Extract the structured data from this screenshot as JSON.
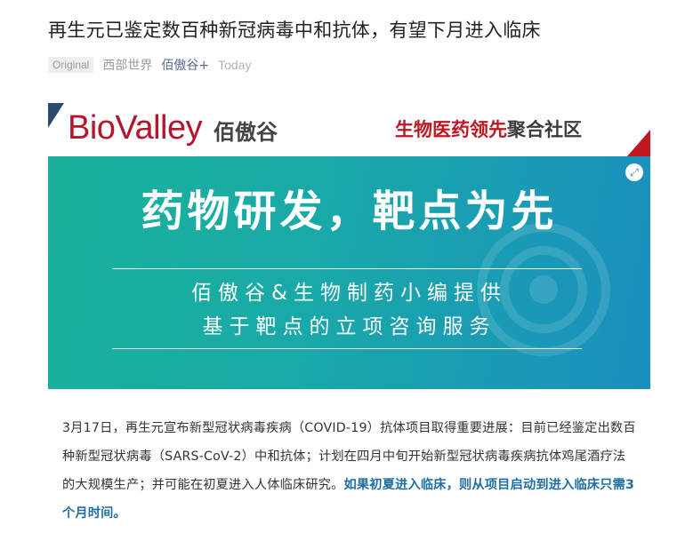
{
  "article": {
    "title": "再生元已鉴定数百种新冠病毒中和抗体，有望下月进入临床",
    "badge": "Original",
    "source": "西部世界",
    "author": "佰傲谷+",
    "date": "Today"
  },
  "banner": {
    "logo_text": "BioValley",
    "logo_cn": "佰傲谷",
    "slogan_red": "生物医药领先",
    "slogan_gray": "聚合社区",
    "headline": "药物研发，靶点为先",
    "sub1": "佰傲谷&生物制药小编提供",
    "sub2": "基于靶点的立项咨询服务",
    "expand_icon": "expand-icon",
    "colors": {
      "red": "#c0161f",
      "teal": "#1ab29a",
      "blue": "#1a8fbf"
    }
  },
  "body": {
    "paragraph": "3月17日，再生元宣布新型冠状病毒疾病（COVID-19）抗体项目取得重要进展：目前已经鉴定出数百种新型冠状病毒（SARS-CoV-2）中和抗体；计划在四月中旬开始新型冠状病毒疾病抗体鸡尾酒疗法的大规模生产；并可能在初夏进入人体临床研究。",
    "highlight": "如果初夏进入临床，则从项目启动到进入临床只需3个月时间。"
  }
}
